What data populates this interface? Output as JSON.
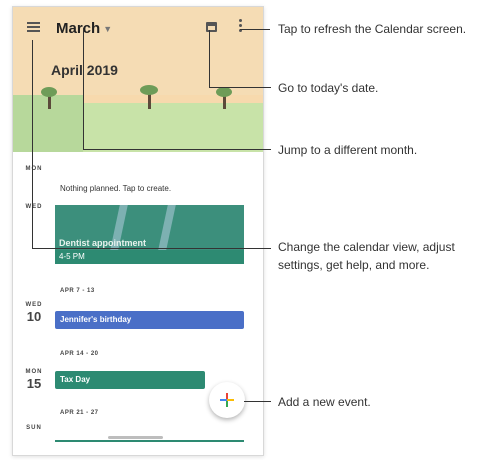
{
  "app": {
    "current_month": "March",
    "header_month": "April 2019"
  },
  "agenda": {
    "days": [
      {
        "dow": "MON",
        "num": ""
      },
      {
        "dow": "WED",
        "num": ""
      },
      {
        "dow": "WED",
        "num": "10"
      },
      {
        "dow": "MON",
        "num": "15"
      },
      {
        "dow": "SUN",
        "num": ""
      }
    ],
    "nothing_planned": "Nothing planned. Tap to create.",
    "dentist_title": "Dentist appointment",
    "dentist_time": "4-5 PM",
    "week_1": "APR 7 - 13",
    "birthday": "Jennifer's birthday",
    "week_2": "APR 14 - 20",
    "tax_day": "Tax Day",
    "week_3": "APR 21 - 27"
  },
  "callouts": {
    "refresh": "Tap to refresh the Calendar screen.",
    "today": "Go to today's date.",
    "month": "Jump to a different month.",
    "menu": "Change the calendar view, adjust settings, get help, and more.",
    "add": "Add a new event."
  },
  "icons": {
    "menu": "menu-icon",
    "today": "calendar-today-icon",
    "more": "more-vert-icon",
    "add": "plus-icon"
  },
  "colors": {
    "event_teal": "#2d8a72",
    "event_blue": "#4a6fc7",
    "header_bg": "#f5dcb4"
  }
}
